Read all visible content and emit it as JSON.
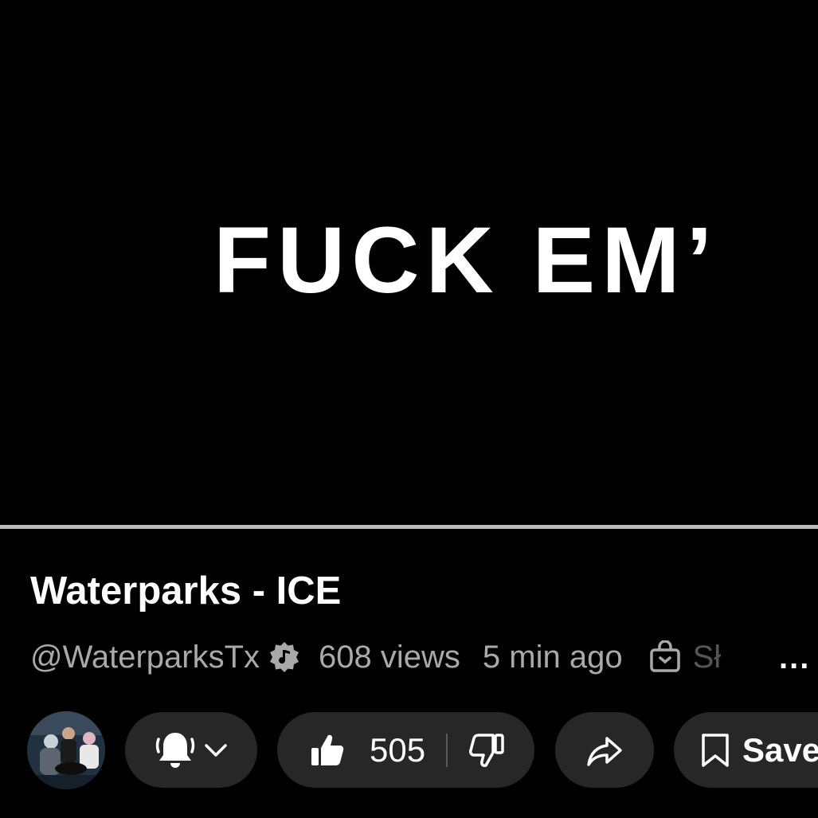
{
  "video": {
    "caption": "FUCK EM’",
    "progress": 0.0
  },
  "video_info": {
    "title": "Waterparks - ICE",
    "channel_handle": "@WaterparksTx",
    "views": "608 views",
    "posted": "5 min ago",
    "shop_label": "Sł",
    "more_label": "..."
  },
  "actions": {
    "like_count": "505",
    "save_label": "Save"
  },
  "icons": {
    "verified": "music-note-verified-badge-icon",
    "shop": "shopping-bag-icon",
    "bell": "notification-bell-icon",
    "chevron": "chevron-down-icon",
    "like": "thumbs-up-icon",
    "dislike": "thumbs-down-icon",
    "share": "share-arrow-icon",
    "save": "bookmark-icon"
  },
  "colors": {
    "background": "#000000",
    "pill": "#272727",
    "secondary_text": "#a9a9a9",
    "progress_track": "#bdbdbd"
  }
}
